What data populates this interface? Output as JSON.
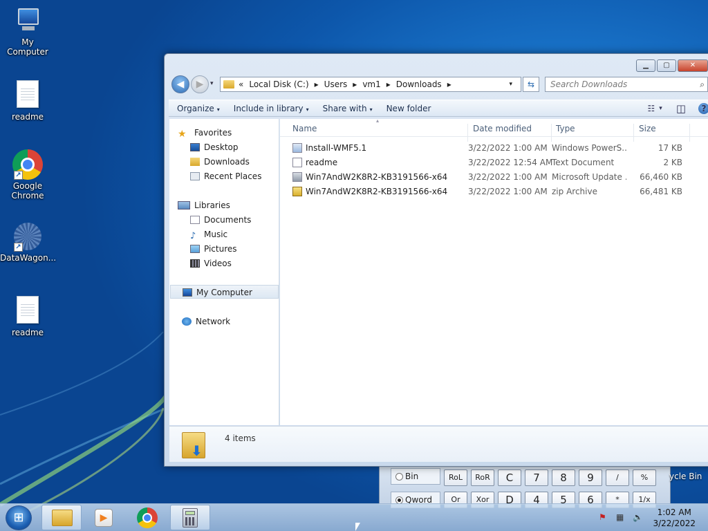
{
  "desktop": {
    "icons": [
      {
        "label": "My Computer"
      },
      {
        "label": "readme"
      },
      {
        "label": "Google Chrome"
      },
      {
        "label": "DataWagon..."
      },
      {
        "label": "readme"
      }
    ],
    "recycle_label": "ycle Bin"
  },
  "window": {
    "caption": {
      "min": "▁",
      "max": "▢",
      "close": "✕"
    },
    "nav": {
      "back": "◀",
      "forward": "▶",
      "recent": "▾"
    },
    "breadcrumb": {
      "prefix": "«",
      "parts": [
        "Local Disk (C:)",
        "Users",
        "vm1",
        "Downloads"
      ],
      "sep": "▸"
    },
    "search": {
      "placeholder": "Search Downloads",
      "icon": "⌕"
    },
    "toolbar": {
      "organize": "Organize",
      "include": "Include in library",
      "share": "Share with",
      "newfolder": "New folder",
      "dropdown": "▾",
      "views": "☷",
      "preview": "◫",
      "help": "?"
    },
    "navpane": {
      "favorites": "Favorites",
      "desktop": "Desktop",
      "downloads": "Downloads",
      "recent": "Recent Places",
      "libraries": "Libraries",
      "documents": "Documents",
      "music": "Music",
      "pictures": "Pictures",
      "videos": "Videos",
      "computer": "My Computer",
      "network": "Network"
    },
    "columns": {
      "name": "Name",
      "date": "Date modified",
      "type": "Type",
      "size": "Size",
      "sort": "▴"
    },
    "files": [
      {
        "name": "Install-WMF5.1",
        "date": "3/22/2022 1:00 AM",
        "type": "Windows PowerS...",
        "size": "17 KB"
      },
      {
        "name": "readme",
        "date": "3/22/2022 12:54 AM",
        "type": "Text Document",
        "size": "2 KB"
      },
      {
        "name": "Win7AndW2K8R2-KB3191566-x64",
        "date": "3/22/2022 1:00 AM",
        "type": "Microsoft Update ...",
        "size": "66,460 KB"
      },
      {
        "name": "Win7AndW2K8R2-KB3191566-x64",
        "date": "3/22/2022 1:00 AM",
        "type": "zip Archive",
        "size": "66,481 KB"
      }
    ],
    "status": {
      "count": "4 items"
    }
  },
  "calculator": {
    "row1": [
      "RoL",
      "RoR",
      "C",
      "7",
      "8",
      "9",
      "/",
      "%"
    ],
    "row2": [
      "Or",
      "Xor",
      "D",
      "4",
      "5",
      "6",
      "*",
      "1/x"
    ],
    "radio_bin": "Bin",
    "radio_qword": "Qword"
  },
  "taskbar": {
    "start": "⊞",
    "time": "1:02 AM",
    "date": "3/22/2022"
  }
}
